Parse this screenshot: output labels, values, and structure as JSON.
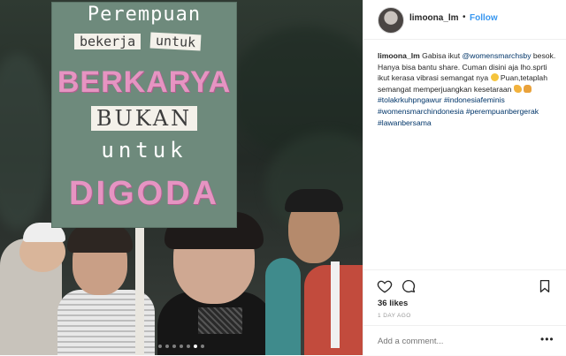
{
  "post": {
    "username": "limoona_lm",
    "separator": "•",
    "follow_label": "Follow",
    "caption": {
      "username": "limoona_lm",
      "text_1": " Gabisa ikut ",
      "mention": "@womensmarchsby",
      "text_2": " besok. Hanya bisa bantu share. Cuman disini aja lho.sprti ikut kerasa vibrasi semangat nya ",
      "text_3": " Puan,tetaplah semangat memperjuangkan kesetaraan ",
      "hashtags": [
        "#tolakrkuhpngawur",
        "#indonesiafeminis",
        "#womensmarchindonesia",
        "#perempuanbergerak",
        "#lawanbersama"
      ]
    },
    "likes": "36 likes",
    "time": "1 DAY AGO",
    "comment_placeholder": "Add a comment...",
    "more_label": "•••",
    "carousel": {
      "count": 7,
      "active_index": 5
    }
  },
  "sign": {
    "line1": "Perempuan",
    "line2": "bekerja",
    "line3": "untuk",
    "line4": "BERKARYA",
    "line5": "BUKAN",
    "line6": "untuk",
    "line7": "DIGODA"
  },
  "icons": {
    "like": "heart-icon",
    "comment": "comment-bubble-icon",
    "save": "bookmark-icon",
    "emoji_1": "heart-eyes-emoji-icon",
    "emoji_2": "flexed-biceps-emoji-icon",
    "emoji_3": "raising-hand-emoji-icon"
  },
  "colors": {
    "link": "#003569",
    "follow": "#3897f0",
    "sign_background": "#6e8a7c",
    "sign_pink": "#e694c2"
  }
}
